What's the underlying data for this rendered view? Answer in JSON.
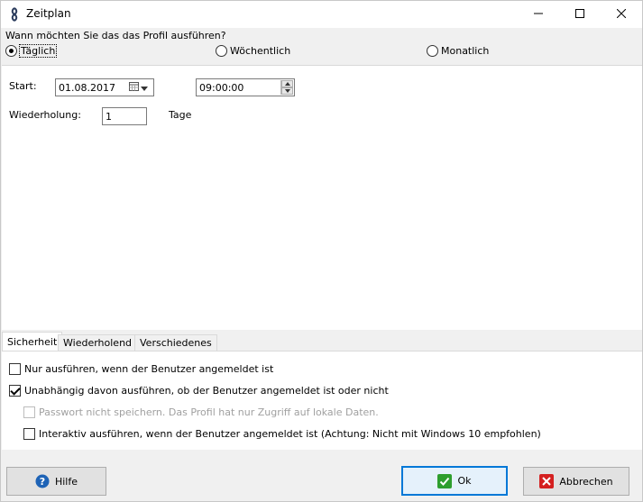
{
  "window": {
    "title": "Zeitplan"
  },
  "schedule": {
    "question": "Wann möchten Sie das das Profil ausführen?",
    "frequency_options": [
      {
        "label": "Täglich",
        "selected": true
      },
      {
        "label": "Wöchentlich",
        "selected": false
      },
      {
        "label": "Monatlich",
        "selected": false
      }
    ],
    "start_label": "Start:",
    "start_date": "01.08.2017",
    "start_time": "09:00:00",
    "repeat_label": "Wiederholung:",
    "repeat_value": "1",
    "repeat_unit": "Tage"
  },
  "tabs": [
    {
      "label": "Sicherheit",
      "active": true
    },
    {
      "label": "Wiederholend",
      "active": false
    },
    {
      "label": "Verschiedenes",
      "active": false
    }
  ],
  "security": {
    "options": [
      {
        "label": "Nur ausführen, wenn der Benutzer angemeldet ist",
        "checked": false,
        "enabled": true
      },
      {
        "label": "Unabhängig davon ausführen, ob der Benutzer angemeldet ist oder nicht",
        "checked": true,
        "enabled": true
      },
      {
        "label": "Passwort nicht speichern. Das Profil hat nur Zugriff auf lokale Daten.",
        "checked": false,
        "enabled": false
      },
      {
        "label": "Interaktiv ausführen, wenn der Benutzer angemeldet ist (Achtung: Nicht mit Windows 10 empfohlen)",
        "checked": false,
        "enabled": true
      }
    ]
  },
  "footer": {
    "help_label": "Hilfe",
    "ok_label": "Ok",
    "cancel_label": "Abbrechen"
  },
  "colors": {
    "accent": "#0078d7",
    "help_icon": "#1e63b6",
    "ok_icon": "#2e9e2e",
    "cancel_icon": "#d42020"
  }
}
